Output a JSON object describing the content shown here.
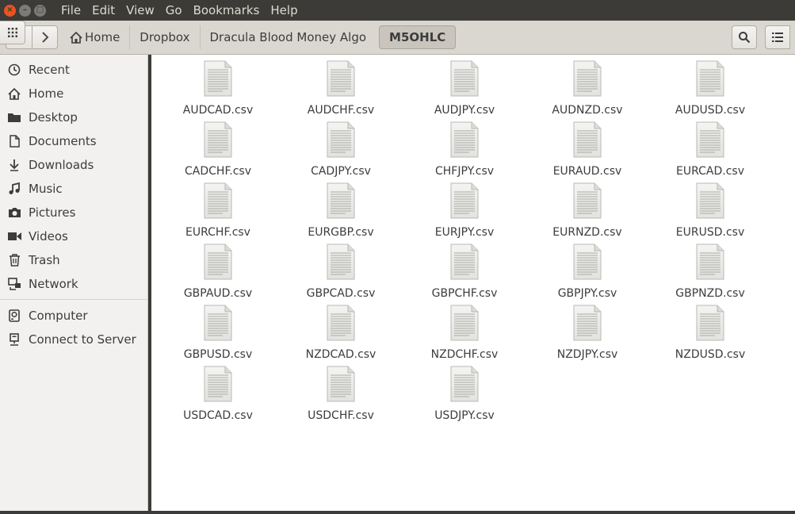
{
  "menubar": {
    "items": [
      "File",
      "Edit",
      "View",
      "Go",
      "Bookmarks",
      "Help"
    ]
  },
  "toolbar": {
    "breadcrumbs": [
      "Home",
      "Dropbox",
      "Dracula Blood Money Algo",
      "M5OHLC"
    ]
  },
  "sidebar": {
    "places": [
      {
        "label": "Recent",
        "icon": "clock-icon"
      },
      {
        "label": "Home",
        "icon": "home-icon"
      },
      {
        "label": "Desktop",
        "icon": "folder-icon"
      },
      {
        "label": "Documents",
        "icon": "document-icon"
      },
      {
        "label": "Downloads",
        "icon": "download-icon"
      },
      {
        "label": "Music",
        "icon": "music-icon"
      },
      {
        "label": "Pictures",
        "icon": "camera-icon"
      },
      {
        "label": "Videos",
        "icon": "video-icon"
      },
      {
        "label": "Trash",
        "icon": "trash-icon"
      },
      {
        "label": "Network",
        "icon": "network-icon"
      }
    ],
    "devices": [
      {
        "label": "Computer",
        "icon": "drive-icon"
      },
      {
        "label": "Connect to Server",
        "icon": "server-icon"
      }
    ]
  },
  "files": [
    "AUDCAD.csv",
    "AUDCHF.csv",
    "AUDJPY.csv",
    "AUDNZD.csv",
    "AUDUSD.csv",
    "CADCHF.csv",
    "CADJPY.csv",
    "CHFJPY.csv",
    "EURAUD.csv",
    "EURCAD.csv",
    "EURCHF.csv",
    "EURGBP.csv",
    "EURJPY.csv",
    "EURNZD.csv",
    "EURUSD.csv",
    "GBPAUD.csv",
    "GBPCAD.csv",
    "GBPCHF.csv",
    "GBPJPY.csv",
    "GBPNZD.csv",
    "GBPUSD.csv",
    "NZDCAD.csv",
    "NZDCHF.csv",
    "NZDJPY.csv",
    "NZDUSD.csv",
    "USDCAD.csv",
    "USDCHF.csv",
    "USDJPY.csv"
  ],
  "colors": {
    "accent_close": "#e95420",
    "menubar_bg": "#3c3b37",
    "toolbar_bg": "#dad7d0",
    "sidebar_bg": "#f2f1f0"
  }
}
